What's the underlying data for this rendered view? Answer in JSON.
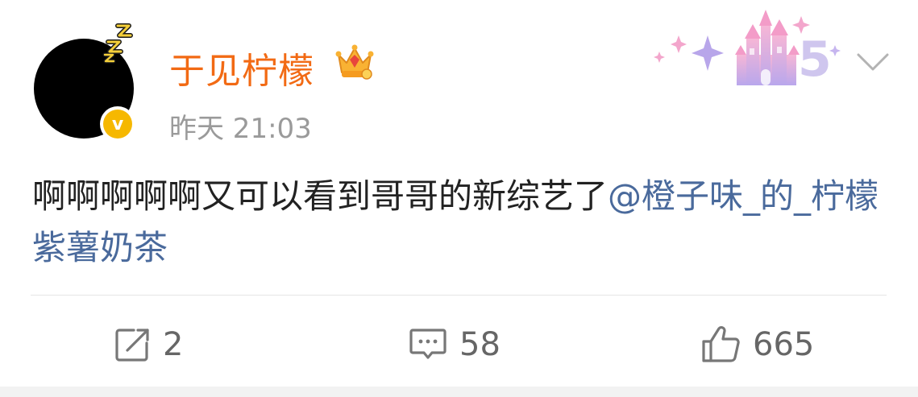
{
  "post": {
    "username": "于见柠檬",
    "timestamp": "昨天 21:03",
    "text_main": "啊啊啊啊啊又可以看到哥哥的新综艺了",
    "mention": "@橙子味_的_柠檬紫薯奶茶",
    "badges": {
      "vip": "v",
      "crown_icon": "crown-icon",
      "avatar_status_icon": "sleeping-zzz-icon",
      "decoration": "castle-5-anniversary-decoration"
    }
  },
  "actions": {
    "repost_count": "2",
    "comment_count": "58",
    "like_count": "665"
  },
  "colors": {
    "username": "#f26a14",
    "mention": "#4a6a9c",
    "timestamp": "#9a9a9a",
    "text": "#222222",
    "vip_badge": "#f6b800"
  }
}
